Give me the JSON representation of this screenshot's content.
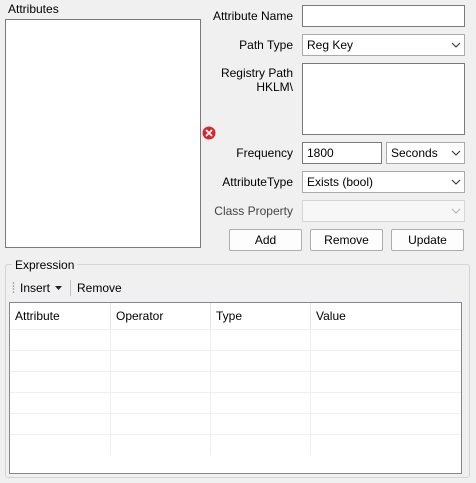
{
  "attributes_panel": {
    "title": "Attributes"
  },
  "form": {
    "attribute_name_label": "Attribute Name",
    "attribute_name_value": "",
    "path_type_label": "Path Type",
    "path_type_value": "Reg Key",
    "registry_path_label_line1": "Registry Path",
    "registry_path_label_line2": "HKLM\\",
    "registry_path_value": "",
    "frequency_label": "Frequency",
    "frequency_value": "1800",
    "frequency_unit_value": "Seconds",
    "attribute_type_label": "AttributeType",
    "attribute_type_value": "Exists (bool)",
    "class_property_label": "Class Property",
    "class_property_value": "",
    "add_label": "Add",
    "remove_label": "Remove",
    "update_label": "Update",
    "error_icon_color": "#d9262c"
  },
  "expression": {
    "title": "Expression",
    "toolbar": {
      "insert_label": "Insert",
      "remove_label": "Remove"
    },
    "columns": [
      "Attribute",
      "Operator",
      "Type",
      "Value"
    ],
    "empty_rows": 6
  }
}
